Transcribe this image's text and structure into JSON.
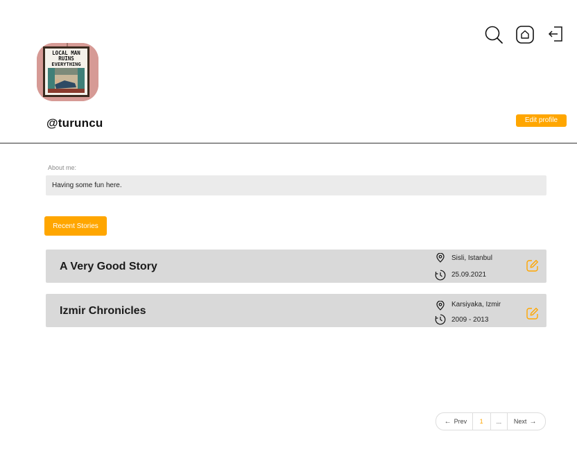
{
  "header": {
    "icons": [
      "search-icon",
      "home-icon",
      "logout-icon"
    ]
  },
  "profile": {
    "avatar_sign_text": [
      "LOCAL MAN",
      "RUINS",
      "EVERYTHING"
    ],
    "username": "@turuncu",
    "edit_label": "Edit profile"
  },
  "about": {
    "label": "About me:",
    "text": "Having some fun here."
  },
  "recent": {
    "button_label": "Recent Stories"
  },
  "stories": [
    {
      "title": "A Very Good Story",
      "location": "Sisli, Istanbul",
      "date": "25.09.2021"
    },
    {
      "title": "Izmir Chronicles",
      "location": "Karsiyaka, Izmir",
      "date": "2009 - 2013"
    }
  ],
  "pagination": {
    "prev_label": "Prev",
    "current_page": "1",
    "ellipsis": "...",
    "next_label": "Next"
  },
  "colors": {
    "accent": "#ffa600",
    "story_bg": "#d9d9d9",
    "about_bg": "#ebebeb"
  }
}
